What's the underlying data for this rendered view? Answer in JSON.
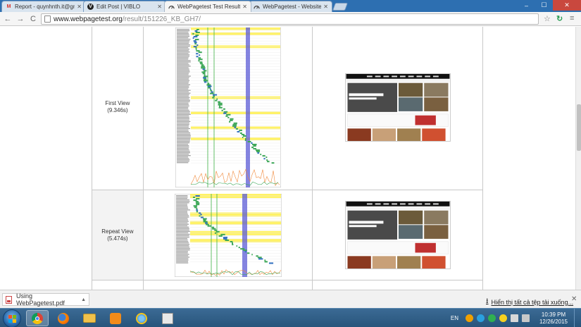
{
  "window": {
    "tabs": [
      {
        "label": "Report - quynhnth.it@gm",
        "icon": "gmail-icon",
        "active": false
      },
      {
        "label": "Edit Post | VIBLO",
        "icon": "viblo-icon",
        "active": false
      },
      {
        "label": "WebPagetest Test Result",
        "icon": "webpagetest-icon",
        "active": true
      },
      {
        "label": "WebPagetest - Website Pe",
        "icon": "webpagetest-icon",
        "active": false
      }
    ],
    "controls": {
      "minimize": "–",
      "maximize": "☐",
      "close": "✕"
    }
  },
  "toolbar": {
    "back": "←",
    "forward": "→",
    "reload": "C",
    "url_host": "www.webpagetest.org",
    "url_path": "/result/151226_KB_GH7/",
    "star": "☆",
    "ext": "↻",
    "menu": "≡"
  },
  "results": [
    {
      "label": "First View",
      "time": "(9.346s)"
    },
    {
      "label": "Repeat View",
      "time": "(5.474s)"
    }
  ],
  "download_bar": {
    "file_name": "Using WebPagetest.pdf",
    "caret": "▲",
    "show_all": "Hiển thị tất cả tệp tải xuống...",
    "close": "✕"
  },
  "taskbar": {
    "language": "EN",
    "time": "10:39 PM",
    "date": "12/26/2015"
  },
  "colors": {
    "tabstrip": "#2d6fb1",
    "waterfall_highlight": "#fff266",
    "waterfall_vline_green": "#3cb043",
    "waterfall_vline_blue": "#5b5bd6",
    "bar_green": "#3aa655",
    "bar_blue": "#2f6fbf"
  }
}
